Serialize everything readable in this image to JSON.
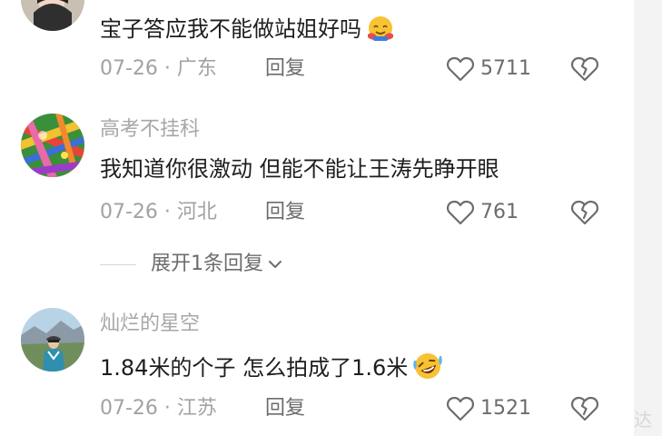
{
  "comments": [
    {
      "content": "宝子答应我不能做站姐好吗",
      "date": "07-26",
      "separator": " · ",
      "location": "广东",
      "reply_label": "回复",
      "likes": "5711",
      "emoji_icon": "hug-emoji-icon"
    },
    {
      "username": "高考不挂科",
      "content": "我知道你很激动 但能不能让王涛先睁开眼",
      "date": "07-26",
      "separator": " · ",
      "location": "河北",
      "reply_label": "回复",
      "likes": "761"
    },
    {
      "username": "灿烂的星空",
      "content": "1.84米的个子  怎么拍成了1.6米",
      "date": "07-26",
      "separator": " · ",
      "location": "江苏",
      "reply_label": "回复",
      "likes": "1521",
      "emoji_icon": "rolling-laugh-emoji-icon"
    }
  ],
  "expand_replies": {
    "label": "展开1条回复"
  },
  "watermark": "达",
  "colors": {
    "text_primary": "#1e1e1e",
    "text_secondary": "#a2a2a2",
    "text_action": "#6c6c6c"
  }
}
